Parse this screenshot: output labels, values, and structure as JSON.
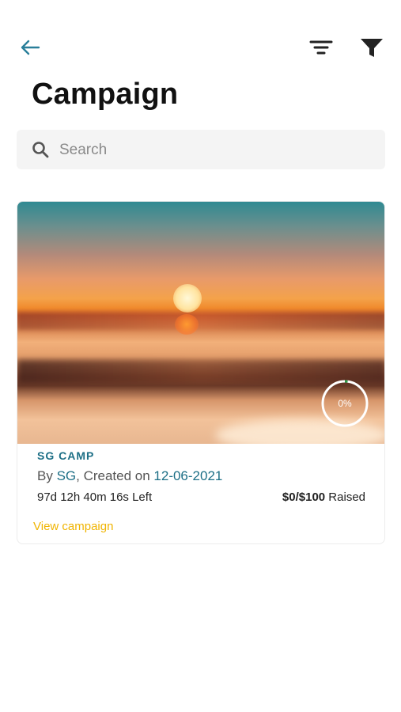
{
  "header": {
    "title": "Campaign",
    "back_icon": "arrow-left-icon",
    "sort_icon": "sort-lines-icon",
    "filter_icon": "funnel-filter-icon",
    "accent_color": "#2a7f9a"
  },
  "search": {
    "placeholder": "Search",
    "value": ""
  },
  "campaigns": [
    {
      "name": "SG CAMP",
      "by_prefix": "By ",
      "author": "SG",
      "created_text": ", Created on ",
      "created_date": "12-06-2021",
      "time_left": "97d 12h 40m 16s Left",
      "raised_amount": "$0/$100",
      "raised_suffix": " Raised",
      "progress_label": "0%",
      "progress_fraction": 0.0,
      "view_label": "View campaign",
      "name_color": "#1d6f86",
      "link_color": "#f0b400"
    }
  ]
}
